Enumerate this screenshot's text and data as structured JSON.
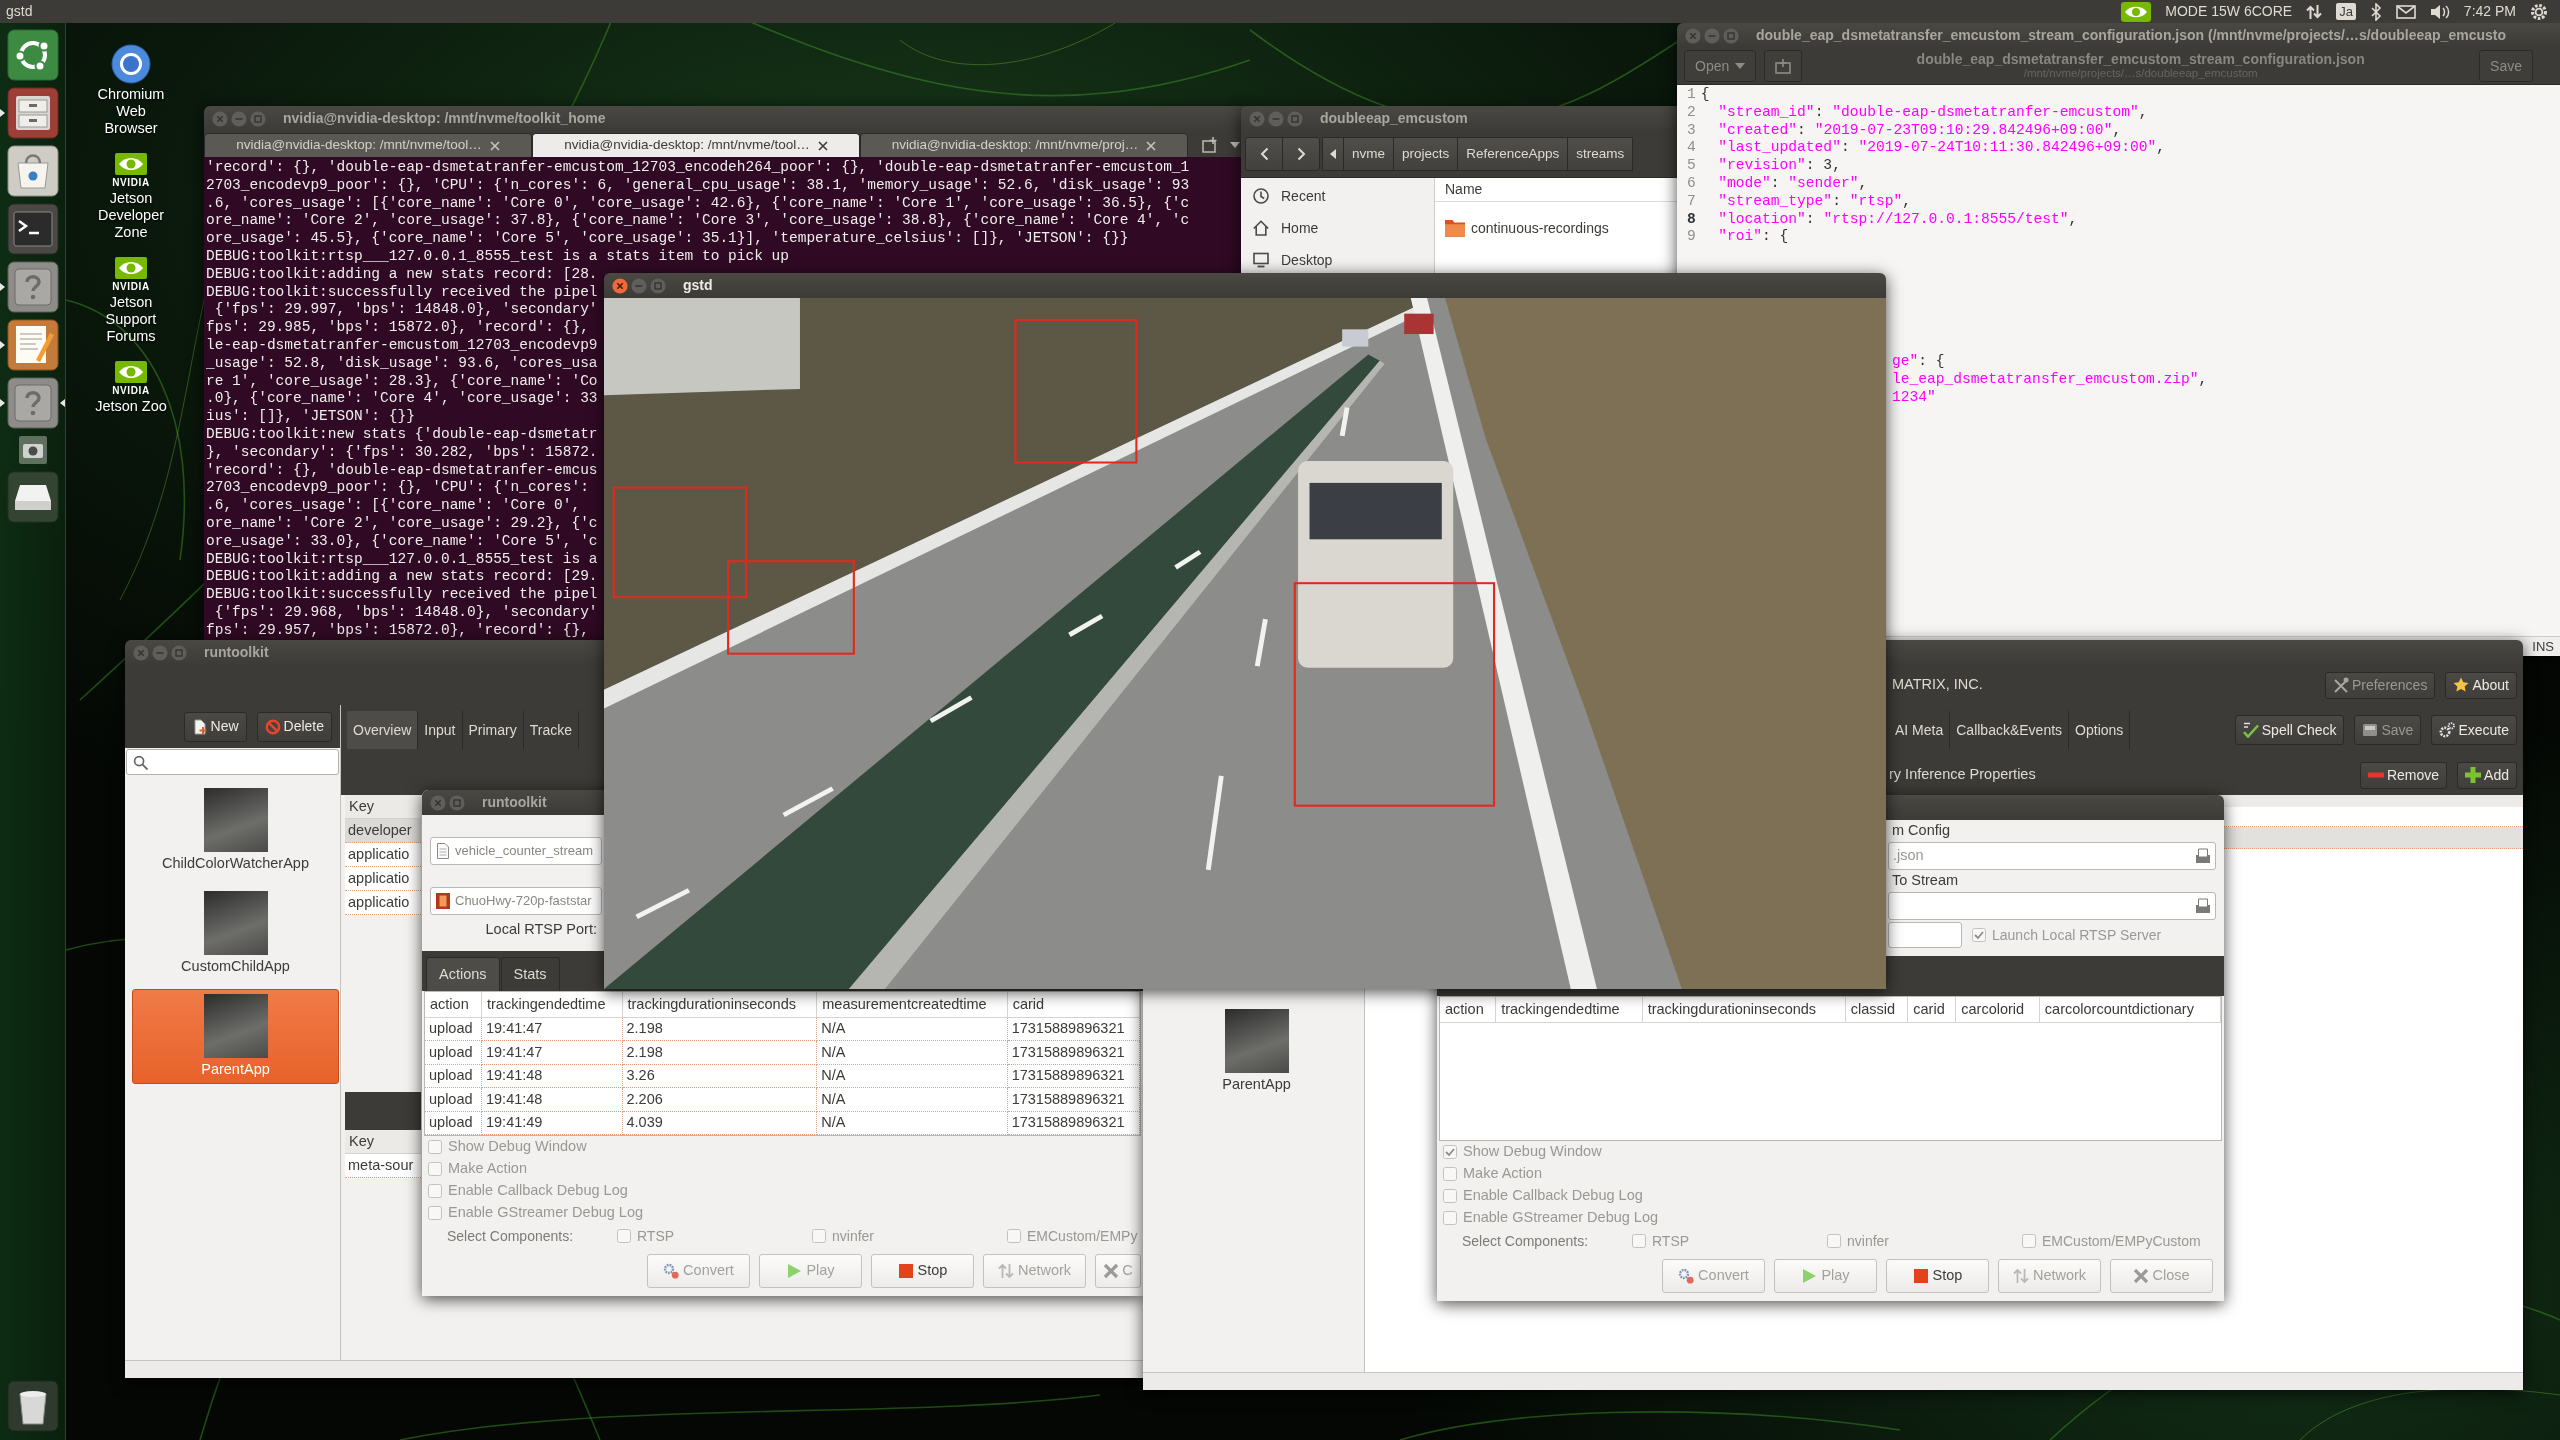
{
  "top_bar": {
    "title": "gstd",
    "mode": "MODE 15W 6CORE",
    "input_method": "Ja",
    "clock": "7:42 PM"
  },
  "dock": [
    {
      "kind": "launcher",
      "running": false,
      "active": false
    },
    {
      "kind": "files",
      "running": true,
      "active": false
    },
    {
      "kind": "software",
      "running": false,
      "active": false
    },
    {
      "kind": "terminal",
      "running": false,
      "active": false
    },
    {
      "kind": "help",
      "running": true,
      "active": false
    },
    {
      "kind": "editor",
      "running": true,
      "active": false
    },
    {
      "kind": "help",
      "running": true,
      "active": true
    },
    {
      "kind": "camera",
      "running": false,
      "active": false
    },
    {
      "kind": "drive",
      "running": false,
      "active": false
    },
    {
      "kind": "trash",
      "running": false,
      "active": false
    }
  ],
  "desktop_icons": [
    {
      "kind": "browser",
      "label": "Chromium Web Browser"
    },
    {
      "kind": "nvidia",
      "logo_text": "NVIDIA",
      "label": "Jetson Developer Zone"
    },
    {
      "kind": "nvidia",
      "logo_text": "NVIDIA",
      "label": "Jetson Support Forums"
    },
    {
      "kind": "nvidia",
      "logo_text": "NVIDIA",
      "label": "Jetson Zoo"
    }
  ],
  "terminal": {
    "title": "nvidia@nvidia-desktop: /mnt/nvme/toolkit_home",
    "focused": false,
    "tabs": [
      {
        "label": "nvidia@nvidia-desktop: /mnt/nvme/tool…",
        "selected": false
      },
      {
        "label": "nvidia@nvidia-desktop: /mnt/nvme/tool…",
        "selected": true
      },
      {
        "label": "nvidia@nvidia-desktop: /mnt/nvme/proj…",
        "selected": false
      }
    ],
    "lines": [
      "'record': {}, 'double-eap-dsmetatranfer-emcustom_12703_encodeh264_poor': {}, 'double-eap-dsmetatranfer-emcustom_1",
      "2703_encodevp9_poor': {}, 'CPU': {'n_cores': 6, 'general_cpu_usage': 38.1, 'memory_usage': 52.6, 'disk_usage': 93",
      ".6, 'cores_usage': [{'core_name': 'Core 0', 'core_usage': 42.6}, {'core_name': 'Core 1', 'core_usage': 36.5}, {'c",
      "ore_name': 'Core 2', 'core_usage': 37.8}, {'core_name': 'Core 3', 'core_usage': 38.8}, {'core_name': 'Core 4', 'c",
      "ore_usage': 45.5}, {'core_name': 'Core 5', 'core_usage': 35.1}], 'temperature_celsius': []}, 'JETSON': {}}",
      "DEBUG:toolkit:rtsp___127.0.0.1_8555_test is a stats item to pick up",
      "DEBUG:toolkit:adding a new stats record: [28.",
      "DEBUG:toolkit:successfully received the pipel",
      " {'fps': 29.997, 'bps': 14848.0}, 'secondary'",
      "fps': 29.985, 'bps': 15872.0}, 'record': {},",
      "le-eap-dsmetatranfer-emcustom_12703_encodevp9",
      "_usage': 52.8, 'disk_usage': 93.6, 'cores_usa",
      "re 1', 'core_usage': 28.3}, {'core_name': 'Co",
      ".0}, {'core_name': 'Core 4', 'core_usage': 33",
      "ius': []}, 'JETSON': {}}",
      "DEBUG:toolkit:new stats {'double-eap-dsmetatr",
      "}, 'secondary': {'fps': 30.282, 'bps': 15872.",
      "'record': {}, 'double-eap-dsmetatranfer-emcus",
      "2703_encodevp9_poor': {}, 'CPU': {'n_cores':",
      ".6, 'cores_usage': [{'core_name': 'Core 0',",
      "ore_name': 'Core 2', 'core_usage': 29.2}, {'c",
      "ore_usage': 33.0}, {'core_name': 'Core 5', 'c",
      "DEBUG:toolkit:rtsp___127.0.0.1_8555_test is a",
      "DEBUG:toolkit:adding a new stats record: [29.",
      "DEBUG:toolkit:successfully received the pipel",
      " {'fps': 29.968, 'bps': 14848.0}, 'secondary'",
      "fps': 29.957, 'bps': 15872.0}, 'record': {},"
    ]
  },
  "file_manager": {
    "title": "doubleeap_emcustom",
    "focused": false,
    "path": [
      "nvme",
      "projects",
      "ReferenceApps",
      "streams"
    ],
    "places": [
      {
        "kind": "recent",
        "label": "Recent"
      },
      {
        "kind": "home",
        "label": "Home"
      },
      {
        "kind": "desktop",
        "label": "Desktop"
      }
    ],
    "column": "Name",
    "items": [
      {
        "kind": "folder",
        "name": "continuous-recordings"
      }
    ]
  },
  "editor": {
    "title": "double_eap_dsmetatransfer_emcustom_stream_configuration.json (/mnt/nvme/projects/…s/doubleeap_emcusto",
    "focused": false,
    "open_label": "Open",
    "header_title": "double_eap_dsmetatransfer_emcustom_stream_configuration.json",
    "header_subtitle": "/mnt/nvme/projects/…s/doubleeap_emcustom",
    "save_label": "Save",
    "lines": [
      {
        "number": "1",
        "text": "{",
        "current": false
      },
      {
        "number": "2",
        "text": "  \"stream_id\": \"double-eap-dsmetatranfer-emcustom\",",
        "current": false
      },
      {
        "number": "3",
        "text": "  \"created\": \"2019-07-23T09:10:29.842496+09:00\",",
        "current": false
      },
      {
        "number": "4",
        "text": "  \"last_updated\": \"2019-07-24T10:11:30.842496+09:00\",",
        "current": false
      },
      {
        "number": "5",
        "text": "  \"revision\": 3,",
        "current": false
      },
      {
        "number": "6",
        "text": "  \"mode\": \"sender\",",
        "current": false
      },
      {
        "number": "7",
        "text": "  \"stream_type\": \"rtsp\",",
        "current": false
      },
      {
        "number": "8",
        "text": "  \"location\": \"rtsp://127.0.0.1:8555/test\",",
        "current": true
      },
      {
        "number": "9",
        "text": "  \"roi\": {",
        "current": false
      }
    ],
    "fragments": [
      "ge\": {",
      "le_eap_dsmetatransfer_emcustom.zip\",",
      "1234\""
    ],
    "mode": "INS"
  },
  "video_window": {
    "title": "gstd",
    "focused": true
  },
  "app_window_left": {
    "title": "runtoolkit",
    "focused": false,
    "sidebar_buttons": [
      {
        "kind": "new",
        "label": "New"
      },
      {
        "kind": "delete",
        "label": "Delete"
      }
    ],
    "apps": [
      {
        "name": "ChildColorWatcherApp",
        "selected": false
      },
      {
        "name": "CustomChildApp",
        "selected": false
      },
      {
        "name": "ParentApp",
        "selected": true
      }
    ],
    "tabs": [
      {
        "label": "Overview",
        "selected": true
      },
      {
        "label": "Input",
        "selected": false
      },
      {
        "label": "Primary",
        "selected": false
      },
      {
        "label": "Tracke",
        "selected": false
      }
    ],
    "key_table": {
      "header": "Key",
      "rows": [
        {
          "key": "developer",
          "selected": true
        },
        {
          "key": "applicatio",
          "selected": false
        },
        {
          "key": "applicatio",
          "selected": false
        },
        {
          "key": "applicatio",
          "selected": false
        }
      ]
    },
    "lower_table": {
      "header": "Key",
      "rows": [
        {
          "key": "meta-sour",
          "selected": false
        }
      ]
    }
  },
  "dialog_left": {
    "title": "runtoolkit",
    "focused": false,
    "files": [
      {
        "kind": "document",
        "value": "vehicle_counter_stream"
      },
      {
        "kind": "video",
        "value": "ChuoHwy-720p-faststar"
      }
    ],
    "port_label": "Local RTSP Port:",
    "tabs": [
      {
        "label": "Actions",
        "selected": true
      },
      {
        "label": "Stats",
        "selected": false
      }
    ],
    "table": {
      "columns": [
        "action",
        "trackingendedtime",
        "trackingdurationinseconds",
        "measurementcreatedtime",
        "carid"
      ],
      "rows": [
        [
          "upload",
          "19:41:47",
          "2.198",
          "N/A",
          "17315889896321"
        ],
        [
          "upload",
          "19:41:47",
          "2.198",
          "N/A",
          "17315889896321"
        ],
        [
          "upload",
          "19:41:48",
          "3.26",
          "N/A",
          "17315889896321"
        ],
        [
          "upload",
          "19:41:48",
          "2.206",
          "N/A",
          "17315889896321"
        ],
        [
          "upload",
          "19:41:49",
          "4.039",
          "N/A",
          "17315889896321"
        ]
      ]
    },
    "options": [
      {
        "label": "Show Debug Window",
        "checked": false
      },
      {
        "label": "Make Action",
        "checked": false
      },
      {
        "label": "Enable Callback Debug Log",
        "checked": false
      },
      {
        "label": "Enable GStreamer Debug Log",
        "checked": false
      }
    ],
    "components_label": "Select Components:",
    "components": [
      {
        "label": "RTSP",
        "checked": false
      },
      {
        "label": "nvinfer",
        "checked": false
      },
      {
        "label": "EMCustom/EMPy",
        "checked": false
      }
    ],
    "buttons": [
      {
        "kind": "convert",
        "label": "Convert",
        "disabled": true
      },
      {
        "kind": "play",
        "label": "Play",
        "disabled": true
      },
      {
        "kind": "stop",
        "label": "Stop",
        "disabled": false
      },
      {
        "kind": "network",
        "label": "Network",
        "disabled": true
      },
      {
        "kind": "close",
        "label": "C",
        "disabled": true
      }
    ]
  },
  "app_window_right": {
    "company": "MATRIX, INC.",
    "header_buttons": [
      {
        "kind": "preferences",
        "label": "Preferences",
        "disabled": true
      },
      {
        "kind": "about",
        "label": "About",
        "disabled": false
      }
    ],
    "tabs": [
      {
        "label": "AI Meta",
        "selected": false
      },
      {
        "label": "Callback&Events",
        "selected": false
      },
      {
        "label": "Options",
        "selected": false
      }
    ],
    "actions": [
      {
        "kind": "spell",
        "label": "Spell Check",
        "disabled": false
      },
      {
        "kind": "save",
        "label": "Save",
        "disabled": true
      },
      {
        "kind": "execute",
        "label": "Execute",
        "disabled": false
      }
    ],
    "section": "ry Inference Properties",
    "section_buttons": [
      {
        "kind": "remove",
        "label": "Remove"
      },
      {
        "kind": "add",
        "label": "Add"
      }
    ],
    "apps": [
      {
        "name": "ParentApp",
        "selected": false
      }
    ],
    "key_table": {
      "rows": [
        {
          "selected": false
        },
        {
          "selected": true
        }
      ]
    }
  },
  "dialog_right": {
    "config_label": "m Config",
    "config_value": ".json",
    "stream_label": "To Stream",
    "launch": {
      "label": "Launch Local RTSP Server",
      "checked": true
    },
    "table": {
      "columns": [
        "action",
        "trackingendedtime",
        "trackingdurationinseconds",
        "classid",
        "carid",
        "carcolorid",
        "carcolorcountdictionary"
      ]
    },
    "options": [
      {
        "label": "Show Debug Window",
        "checked": true
      },
      {
        "label": "Make Action",
        "checked": false
      },
      {
        "label": "Enable Callback Debug Log",
        "checked": false
      },
      {
        "label": "Enable GStreamer Debug Log",
        "checked": false
      }
    ],
    "components_label": "Select Components:",
    "components": [
      {
        "label": "RTSP",
        "checked": false
      },
      {
        "label": "nvinfer",
        "checked": false
      },
      {
        "label": "EMCustom/EMPyCustom",
        "checked": false
      }
    ],
    "buttons": [
      {
        "kind": "convert",
        "label": "Convert",
        "disabled": true
      },
      {
        "kind": "play",
        "label": "Play",
        "disabled": true
      },
      {
        "kind": "stop",
        "label": "Stop",
        "disabled": false
      },
      {
        "kind": "network",
        "label": "Network",
        "disabled": true
      },
      {
        "kind": "close",
        "label": "Close",
        "disabled": true
      }
    ]
  }
}
